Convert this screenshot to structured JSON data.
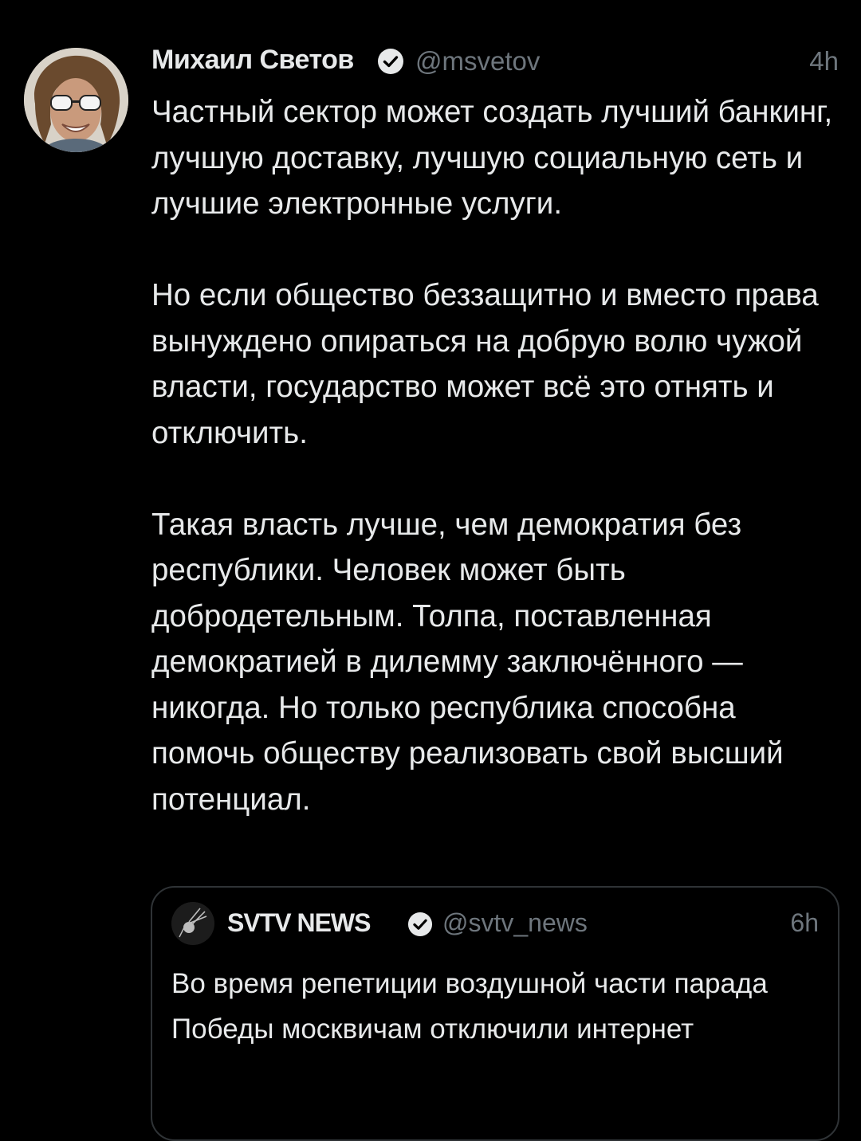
{
  "tweet": {
    "author": {
      "display_name": "Михаил Светов",
      "handle": "@msvetov",
      "verified": true
    },
    "time": "4h",
    "paragraphs": [
      "Частный сектор может создать лучший банкинг, лучшую доставку, лучшую социальную сеть и лучшие электронные услуги.",
      "Но если общество беззащитно и вместо права вынуждено опираться на добрую волю чужой власти, государство может всё это отнять и отключить.",
      "Такая власть лучше, чем демократия без республики. Человек может быть добродетельным. Толпа, поставленная демократией в дилемму заключённого — никогда. Но только республика способна помочь обществу реализовать свой высший потенциал."
    ]
  },
  "quoted_tweet": {
    "author": {
      "display_name": "SVTV NEWS",
      "handle": "@svtv_news",
      "verified": true
    },
    "time": "6h",
    "text": "Во время репетиции воздушной части парада Победы москвичам отключили интернет"
  },
  "colors": {
    "background": "#000000",
    "text_primary": "#e7e9ea",
    "text_secondary": "#6e767d",
    "border": "#2f3336",
    "verified_badge": "#e7e9ea"
  },
  "icons": {
    "verified": "verified-check-icon",
    "author_avatar": "avatar-photo",
    "quote_avatar": "satellite-logo-icon"
  }
}
